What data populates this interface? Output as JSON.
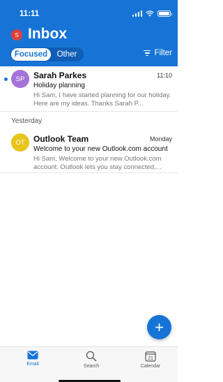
{
  "status_bar": {
    "time": "11:11"
  },
  "header": {
    "account_initial": "S",
    "title": "Inbox",
    "tabs": {
      "focused": "Focused",
      "other": "Other"
    },
    "filter_label": "Filter"
  },
  "messages": [
    {
      "initials": "SP",
      "sender": "Sarah Parkes",
      "time": "11:10",
      "subject": "Holiday planning",
      "preview": "Hi Sam, I have started planning for our holiday. Here are my ideas. Thanks Sarah P...",
      "unread": true,
      "avatar_color": "#a474d8"
    },
    {
      "initials": "OT",
      "sender": "Outlook Team",
      "time": "Monday",
      "subject": "Welcome to your new Outlook.com account",
      "preview": "Hi Sam, Welcome to your new Outlook.com account. Outlook lets you stay connected,...",
      "unread": false,
      "avatar_color": "#e7c51b"
    }
  ],
  "sections": {
    "yesterday": "Yesterday"
  },
  "compose": {
    "icon": "plus-icon",
    "glyph": "+"
  },
  "tabbar": {
    "email": "Email",
    "search": "Search",
    "calendar": "Calendar",
    "calendar_day": "21"
  },
  "colors": {
    "accent": "#1774d6",
    "unread_dot": "#1774d6"
  }
}
